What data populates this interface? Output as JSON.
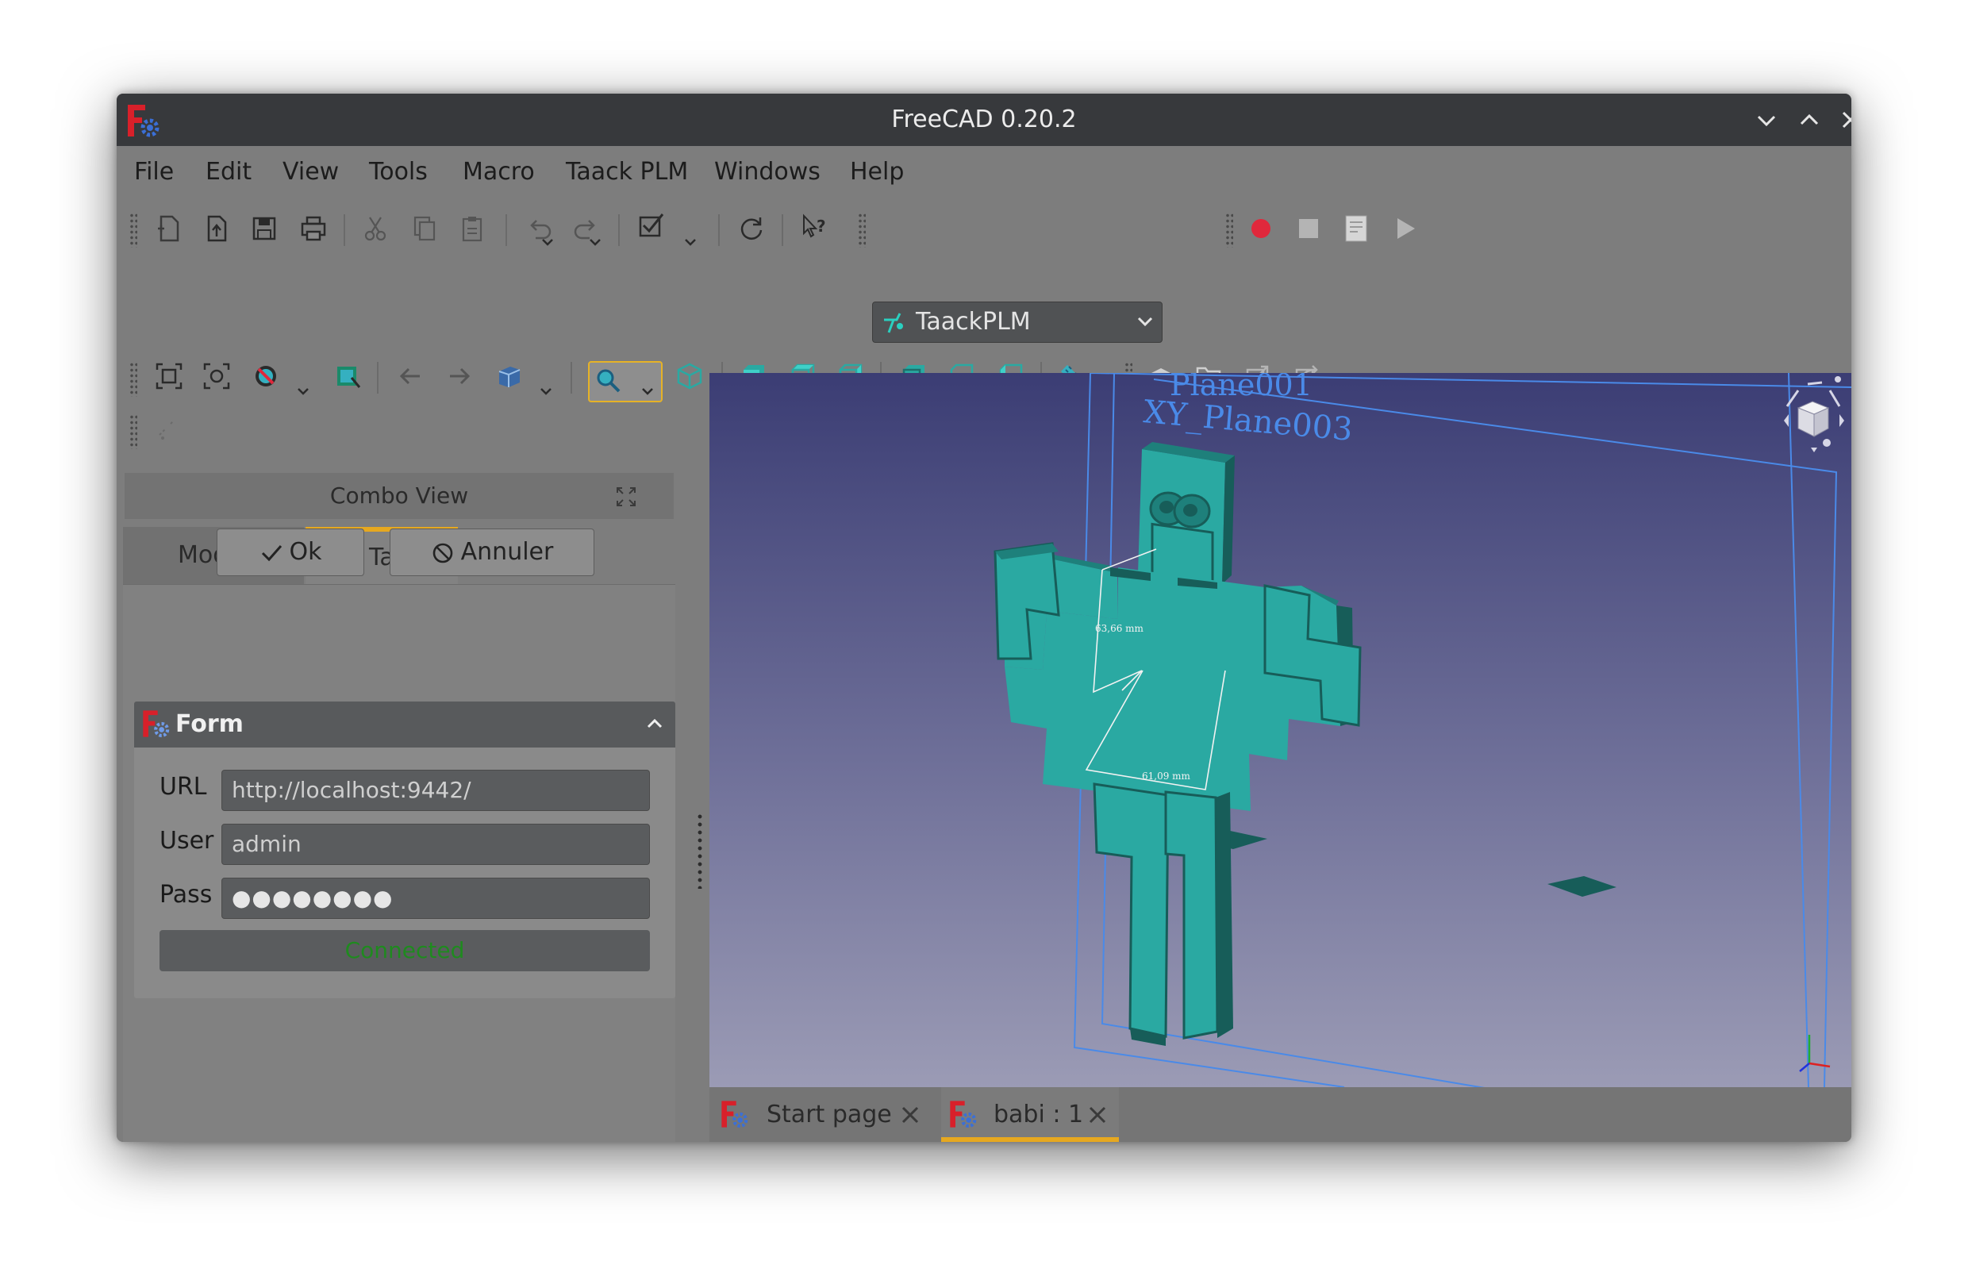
{
  "window": {
    "title": "FreeCAD 0.20.2"
  },
  "menu": [
    "File",
    "Edit",
    "View",
    "Tools",
    "Macro",
    "Taack PLM",
    "Windows",
    "Help"
  ],
  "toolbar": {
    "workbench_selector": "TaackPLM",
    "accent_color": "#e6b227",
    "record_color": "#e0283c"
  },
  "combo_view": {
    "title": "Combo View",
    "tabs": {
      "model": "Model",
      "tasks": "Tasks"
    },
    "ok_label": "Ok",
    "cancel_label": "Annuler",
    "form": {
      "title": "Form",
      "url_label": "URL",
      "url_value": "http://localhost:9442/",
      "user_label": "User",
      "user_value": "admin",
      "pass_label": "Pass",
      "pass_value": "●●●●●●●●",
      "status": "Connected",
      "status_color": "#1f8a1f"
    }
  },
  "viewport": {
    "plane_labels": [
      "Plane001",
      "XY_Plane003"
    ],
    "dimension_labels": [
      "63,66 mm",
      "61,09 mm"
    ],
    "model_color": "#2aa9a2"
  },
  "document_tabs": [
    {
      "label": "Start page",
      "active": false
    },
    {
      "label": "babi : 1",
      "active": true
    }
  ]
}
